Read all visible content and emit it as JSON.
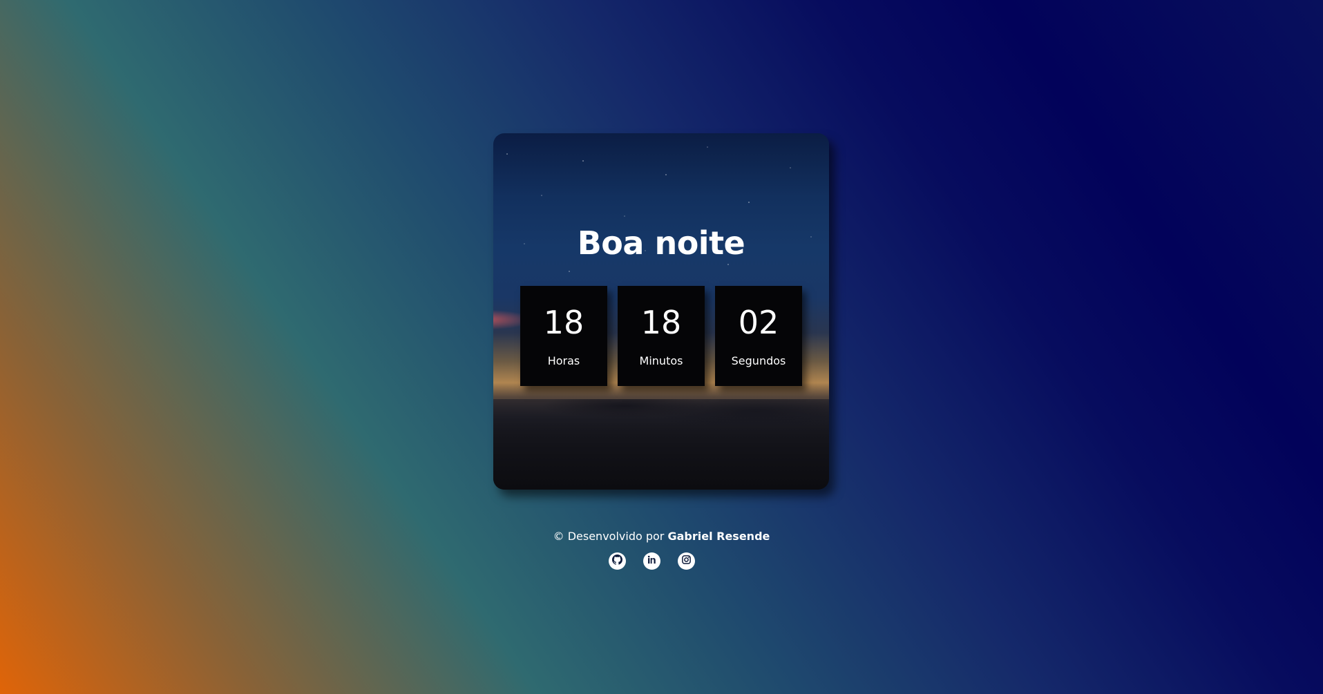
{
  "greeting": "Boa noite",
  "clock": {
    "hours": {
      "value": "18",
      "label": "Horas"
    },
    "minutes": {
      "value": "18",
      "label": "Minutos"
    },
    "seconds": {
      "value": "02",
      "label": "Segundos"
    }
  },
  "footer": {
    "prefix": "© Desenvolvido por",
    "author": "Gabriel Resende"
  },
  "socials": [
    {
      "name": "github-icon"
    },
    {
      "name": "linkedin-icon"
    },
    {
      "name": "instagram-icon"
    }
  ]
}
